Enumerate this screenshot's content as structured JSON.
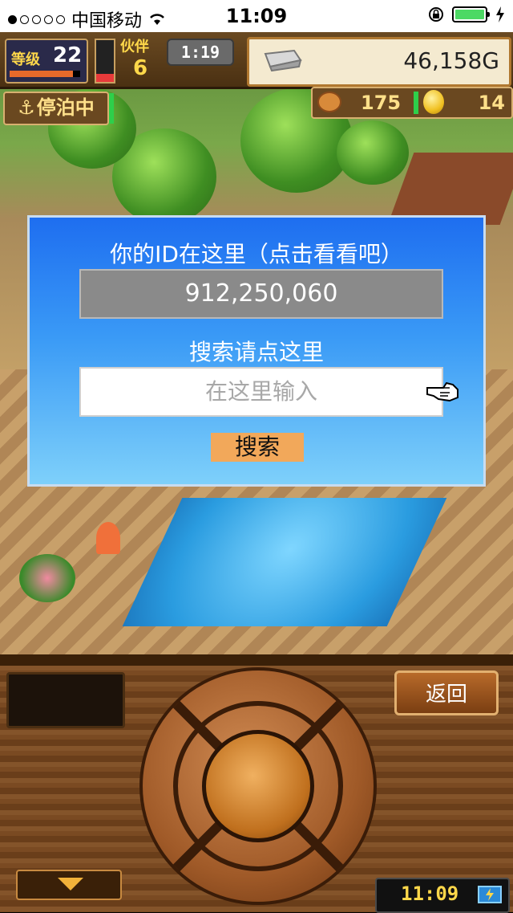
{
  "status_bar": {
    "carrier": "中国移动",
    "time": "11:09"
  },
  "hud": {
    "level_label": "等级",
    "level": "22",
    "crew_label": "伙伴",
    "crew_count": "6",
    "timer": "1:19",
    "gold": "46,158G",
    "docked_label": "停泊中",
    "food": "175",
    "coins": "14"
  },
  "dialog": {
    "id_prompt": "你的ID在这里（点击看看吧）",
    "id_value": "912,250,060",
    "search_prompt": "搜索请点这里",
    "input_placeholder": "在这里输入",
    "search_button": "搜索"
  },
  "controls": {
    "back_button": "返回",
    "clock": "11:09"
  },
  "colors": {
    "dialog_top": "#1e6ef0",
    "dialog_bottom": "#7ed0fa",
    "search_button": "#f2a85a",
    "battery": "#4cd964"
  }
}
